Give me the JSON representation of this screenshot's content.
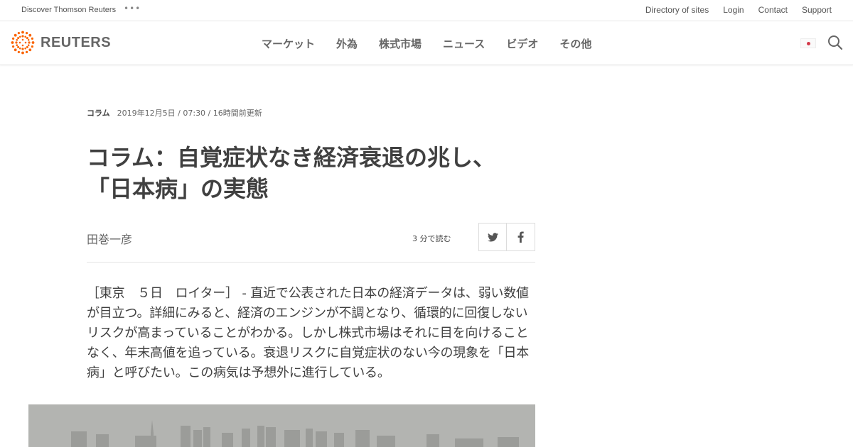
{
  "topbar": {
    "discover": "Discover Thomson Reuters",
    "links": [
      "Directory of sites",
      "Login",
      "Contact",
      "Support"
    ]
  },
  "nav": {
    "logo": "REUTERS",
    "items": [
      "マーケット",
      "外為",
      "株式市場",
      "ニュース",
      "ビデオ",
      "その他"
    ]
  },
  "article": {
    "category": "コラム",
    "date": "2019年12月5日 / 07:30 / 16時間前更新",
    "headline": "コラム：自覚症状なき経済衰退の兆し、「日本病」の実態",
    "author": "田巻一彦",
    "read_time": "3 分で読む",
    "body": "［東京　５日　ロイター］ - 直近で公表された日本の経済データは、弱い数値が目立つ。詳細にみると、経済のエンジンが不調となり、循環的に回復しないリスクが高まっていることがわかる。しかし株式市場はそれに目を向けることなく、年末高値を追っている。衰退リスクに自覚症状のない今の現象を「日本病」と呼びたい。この病気は予想外に進行している。"
  },
  "colors": {
    "text": "#404040",
    "logo_orange": "#fa6400",
    "flag_red": "#d33a4a"
  }
}
